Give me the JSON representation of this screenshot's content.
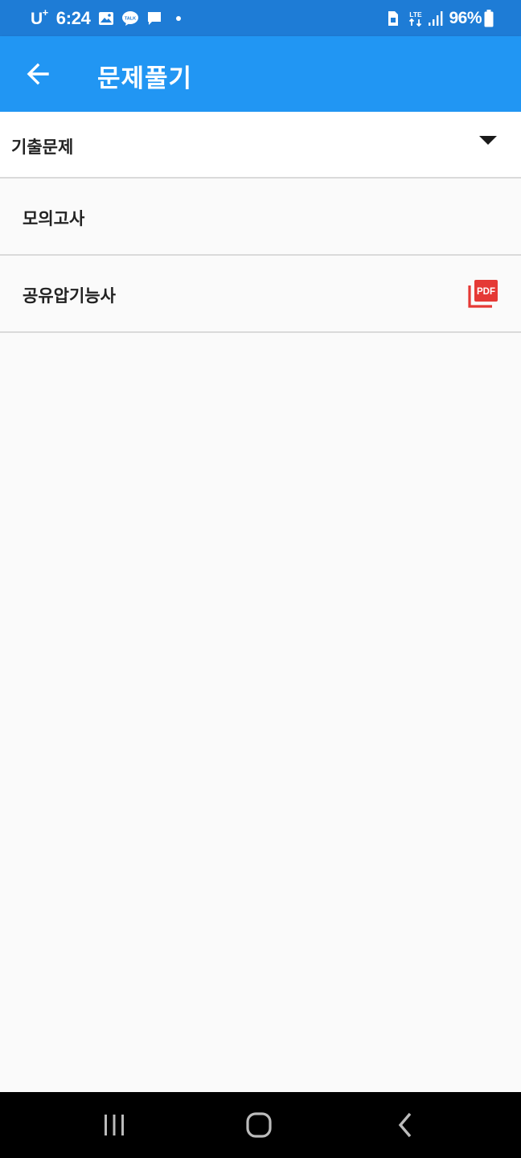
{
  "status_bar": {
    "carrier": "U",
    "carrier_sup": "+",
    "time": "6:24",
    "network": "LTE",
    "battery": "96%",
    "icons": [
      "gallery-icon",
      "talk-icon",
      "message-icon",
      "dot-icon",
      "sim-icon",
      "lte-icon",
      "signal-icon",
      "battery-icon"
    ]
  },
  "app_bar": {
    "title": "문제풀기",
    "back_icon": "arrow-left-icon",
    "background": "#2196f3"
  },
  "dropdown": {
    "selected": "기출문제",
    "icon": "caret-down-icon"
  },
  "list": {
    "items": [
      {
        "label": "모의고사"
      },
      {
        "label": "공유압기능사",
        "icon": "pdf-icon",
        "icon_text": "PDF",
        "icon_color": "#e53935"
      }
    ]
  },
  "nav_bar": {
    "buttons": [
      "recents-icon",
      "home-icon",
      "back-icon"
    ]
  }
}
